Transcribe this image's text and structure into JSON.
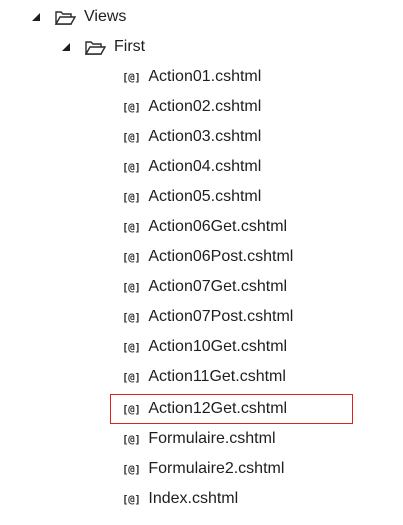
{
  "tree": {
    "root": {
      "label": "Views",
      "expanded": true
    },
    "folder": {
      "label": "First",
      "expanded": true
    },
    "file_icon_text": "[@]",
    "files": [
      "Action01.cshtml",
      "Action02.cshtml",
      "Action03.cshtml",
      "Action04.cshtml",
      "Action05.cshtml",
      "Action06Get.cshtml",
      "Action06Post.cshtml",
      "Action07Get.cshtml",
      "Action07Post.cshtml",
      "Action10Get.cshtml",
      "Action11Get.cshtml",
      "Action12Get.cshtml",
      "Formulaire.cshtml",
      "Formulaire2.cshtml",
      "Index.cshtml"
    ],
    "highlighted_file": "Action12Get.cshtml",
    "highlight_color": "#e0201b"
  }
}
